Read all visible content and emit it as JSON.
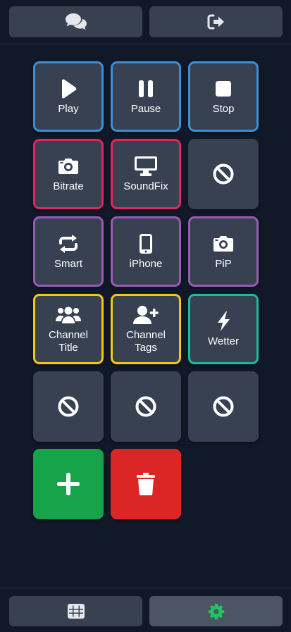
{
  "top_bar": {
    "chat_button": {
      "icon": "comments-icon"
    },
    "logout_button": {
      "icon": "sign-out-icon"
    }
  },
  "tiles": [
    {
      "label": "Play",
      "icon": "play-icon",
      "border": "#3b8fd9"
    },
    {
      "label": "Pause",
      "icon": "pause-icon",
      "border": "#3b8fd9"
    },
    {
      "label": "Stop",
      "icon": "stop-icon",
      "border": "#3b8fd9"
    },
    {
      "label": "Bitrate",
      "icon": "camera-icon",
      "border": "#e0245e"
    },
    {
      "label": "SoundFix",
      "icon": "desktop-icon",
      "border": "#e0245e"
    },
    {
      "label": "",
      "icon": "ban-icon",
      "border": ""
    },
    {
      "label": "Smart",
      "icon": "repeat-icon",
      "border": "#9b59b6"
    },
    {
      "label": "iPhone",
      "icon": "mobile-icon",
      "border": "#9b59b6"
    },
    {
      "label": "PiP",
      "icon": "camera-icon",
      "border": "#9b59b6"
    },
    {
      "label": "Channel\nTitle",
      "icon": "users-icon",
      "border": "#f5c518"
    },
    {
      "label": "Channel\nTags",
      "icon": "user-plus-icon",
      "border": "#f5c518"
    },
    {
      "label": "Wetter",
      "icon": "bolt-icon",
      "border": "#1abc9c"
    },
    {
      "label": "",
      "icon": "ban-icon",
      "border": ""
    },
    {
      "label": "",
      "icon": "ban-icon",
      "border": ""
    },
    {
      "label": "",
      "icon": "ban-icon",
      "border": ""
    }
  ],
  "actions": {
    "add": {
      "icon": "plus-icon",
      "color": "#16a34a"
    },
    "delete": {
      "icon": "trash-icon",
      "color": "#dc2626"
    }
  },
  "bottom_bar": {
    "grid_button": {
      "icon": "grid-icon",
      "active": false
    },
    "settings_button": {
      "icon": "gear-icon",
      "active": true,
      "icon_color": "#22c55e"
    }
  }
}
